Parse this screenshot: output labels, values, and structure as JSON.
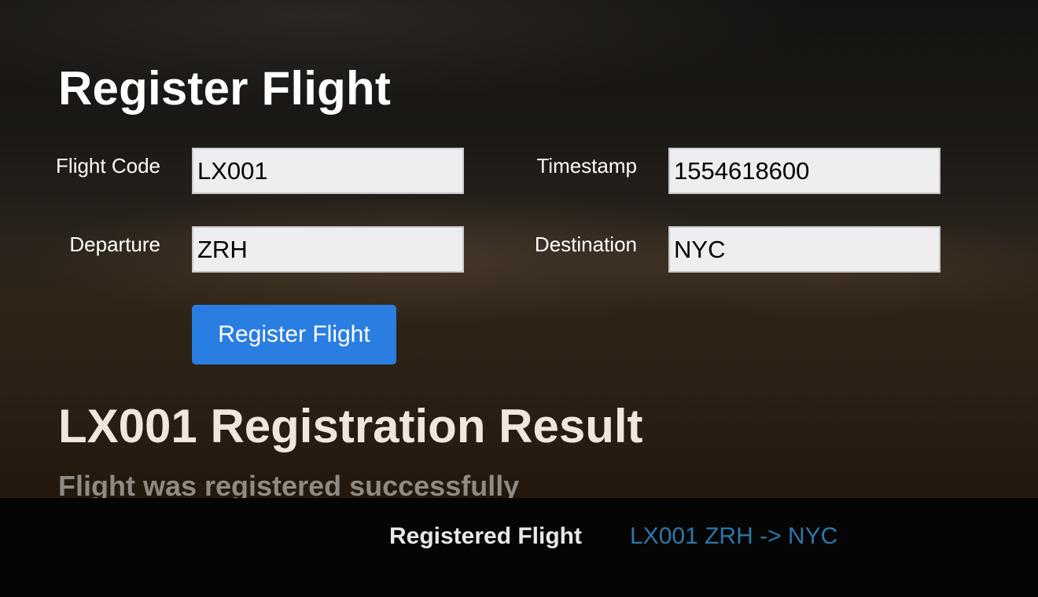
{
  "form": {
    "title": "Register Flight",
    "fields": {
      "flight_code": {
        "label": "Flight Code",
        "value": "LX001"
      },
      "timestamp": {
        "label": "Timestamp",
        "value": "1554618600"
      },
      "departure": {
        "label": "Departure",
        "value": "ZRH"
      },
      "destination": {
        "label": "Destination",
        "value": "NYC"
      }
    },
    "submit_label": "Register Flight"
  },
  "result": {
    "title": "LX001 Registration Result",
    "message": "Flight was registered successfully"
  },
  "footer": {
    "label": "Registered Flight",
    "value": "LX001 ZRH -> NYC"
  },
  "colors": {
    "button": "#2a7de1",
    "link": "#2d77a8",
    "input_background": "#eeeef0"
  }
}
